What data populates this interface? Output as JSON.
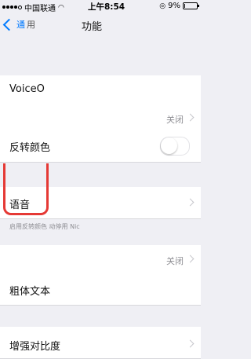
{
  "status_bar": {
    "carrier": "中国联通",
    "time": "上午8:54",
    "battery_percent": "9%",
    "battery_level": 0.09
  },
  "nav": {
    "back_label": "通",
    "back_label_partial": "用",
    "title": "功能"
  },
  "section_header": "",
  "rows": [
    {
      "label": "VoiceO",
      "value": "",
      "kind": "nav"
    },
    {
      "label": "",
      "value": "关闭",
      "kind": "nav"
    },
    {
      "label": "反转颜色",
      "value": "",
      "kind": "toggle",
      "on": false
    },
    {
      "label": "语音",
      "value": "",
      "kind": "nav"
    },
    {
      "label": "",
      "value": "关闭",
      "kind": "nav"
    },
    {
      "label": "粗体文本",
      "value": "",
      "kind": "plain"
    },
    {
      "label": "增强对比度",
      "value": "",
      "kind": "nav"
    }
  ],
  "footer_note": "启用反转颜色      动停用 Nic"
}
